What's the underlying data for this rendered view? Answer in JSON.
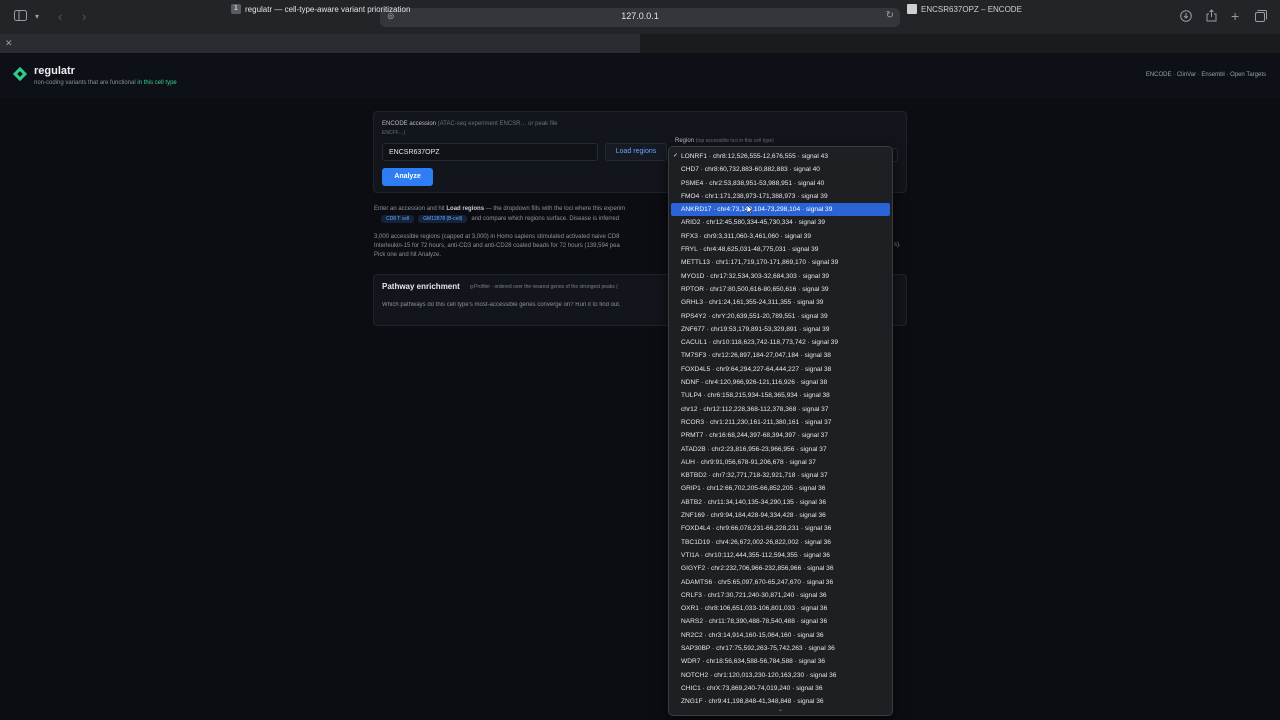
{
  "browser": {
    "url": "127.0.0.1",
    "tabs": [
      {
        "number": "1",
        "title": "regulatr — cell-type-aware variant prioritization"
      },
      {
        "title": "ENCSR637OPZ – ENCODE"
      }
    ]
  },
  "app": {
    "name": "regulatr",
    "tagline_prefix": "non-coding variants that are functional ",
    "tagline_accent": "in this cell type",
    "header_links": "ENCODE · ClinVar · Ensembl · Open Targets"
  },
  "form": {
    "accession_label": "ENCODE accession",
    "accession_hint": "(ATAC-seq experiment ENCSR… or peak file",
    "accession_hint2": "ENCFF…)",
    "accession_value": "ENCSR637OPZ",
    "load_button": "Load regions",
    "analyze_button": "Analyze",
    "region_label": "Region",
    "region_hint": "(top accessible loci in this cell type)"
  },
  "description": {
    "line1_a": "Enter an accession and hit ",
    "line1_b": "Load regions",
    "line1_c": " — the dropdown fills with the loci where this experim",
    "chip1": "CD8 T cell",
    "chip2": "GM12878 (B-cell)",
    "line2_rest": "and compare which regions surface. Disease is inferred",
    "para2_l1": "3,000 accessible regions (capped at 3,000) in Homo sapiens stimulated activated naive CD8",
    "para2_l2": "Interleukin-15 for 72 hours, anti-CD3 and anti-CD28 coated beads for 72 hours (139,594 pea",
    "para2_l3": "Pick one and hit Analyze.",
    "para2_tail": "s)."
  },
  "pathway": {
    "title": "Pathway enrichment",
    "subtitle": "g:Profiler · ordered over the nearest genes of the strongest peaks (",
    "desc": "Which pathways do this cell type's most-accessible genes converge on? Run it to find out."
  },
  "dropdown": {
    "selected_index": 4,
    "checked_index": 0,
    "items": [
      "LONRF1 · chr8:12,526,555-12,676,555 · signal 43",
      "CHD7 · chr8:60,732,883-60,882,883 · signal 40",
      "PSME4 · chr2:53,838,951-53,988,951 · signal 40",
      "FMO4 · chr1:171,238,973-171,388,973 · signal 39",
      "ANKRD17 · chr4:73,148,104-73,298,104 · signal 39",
      "ARID2 · chr12:45,580,334-45,730,334 · signal 39",
      "RFX3 · chr9:3,311,060-3,461,060 · signal 39",
      "FRYL · chr4:48,625,031-48,775,031 · signal 39",
      "METTL13 · chr1:171,719,170-171,869,170 · signal 39",
      "MYO1D · chr17:32,534,303-32,684,303 · signal 39",
      "RPTOR · chr17:80,500,616-80,650,616 · signal 39",
      "GRHL3 · chr1:24,161,355-24,311,355 · signal 39",
      "RPS4Y2 · chrY:20,639,551-20,789,551 · signal 39",
      "ZNF677 · chr19:53,179,891-53,329,891 · signal 39",
      "CACUL1 · chr10:118,623,742-118,773,742 · signal 39",
      "TM7SF3 · chr12:26,897,184-27,047,184 · signal 38",
      "FOXD4L5 · chr9:64,294,227-64,444,227 · signal 38",
      "NDNF · chr4:120,966,926-121,116,926 · signal 38",
      "TULP4 · chr6:158,215,934-158,365,934 · signal 38",
      "chr12 · chr12:112,228,368-112,378,368 · signal 37",
      "RCOR3 · chr1:211,230,161-211,380,161 · signal 37",
      "PRMT7 · chr16:68,244,397-68,394,397 · signal 37",
      "ATAD2B · chr2:23,816,956-23,966,956 · signal 37",
      "AUH · chr9:91,056,678-91,206,678 · signal 37",
      "KBTBD2 · chr7:32,771,718-32,921,718 · signal 37",
      "GRIP1 · chr12:66,702,205-66,852,205 · signal 36",
      "ABTB2 · chr11:34,140,135-34,290,135 · signal 36",
      "ZNF169 · chr9:94,184,428-94,334,428 · signal 36",
      "FOXD4L4 · chr9:66,078,231-66,228,231 · signal 36",
      "TBC1D19 · chr4:26,672,002-26,822,002 · signal 36",
      "VTI1A · chr10:112,444,355-112,594,355 · signal 36",
      "GIGYF2 · chr2:232,706,966-232,856,966 · signal 36",
      "ADAMTS6 · chr5:65,097,670-65,247,670 · signal 36",
      "CRLF3 · chr17:30,721,240-30,871,240 · signal 36",
      "OXR1 · chr8:106,651,033-106,801,033 · signal 36",
      "NARS2 · chr11:78,390,488-78,540,488 · signal 36",
      "NR2C2 · chr3:14,914,160-15,064,160 · signal 36",
      "SAP30BP · chr17:75,592,263-75,742,263 · signal 36",
      "WDR7 · chr18:56,634,588-56,784,588 · signal 36",
      "NOTCH2 · chr1:120,013,230-120,163,230 · signal 36",
      "CHIC1 · chrX:73,869,240-74,019,240 · signal 36",
      "ZNG1F · chr9:41,198,848-41,348,848 · signal 36"
    ]
  },
  "icons": {
    "sidebar": "sidebar-icon",
    "back": "back-icon",
    "forward": "forward-icon",
    "download": "download-icon",
    "share": "share-icon",
    "new_tab": "plus-icon",
    "tabs": "tabs-icon"
  },
  "colors": {
    "accent_blue": "#2f7df5",
    "brand_green": "#2fcf8b",
    "selection": "#2a63d6"
  }
}
